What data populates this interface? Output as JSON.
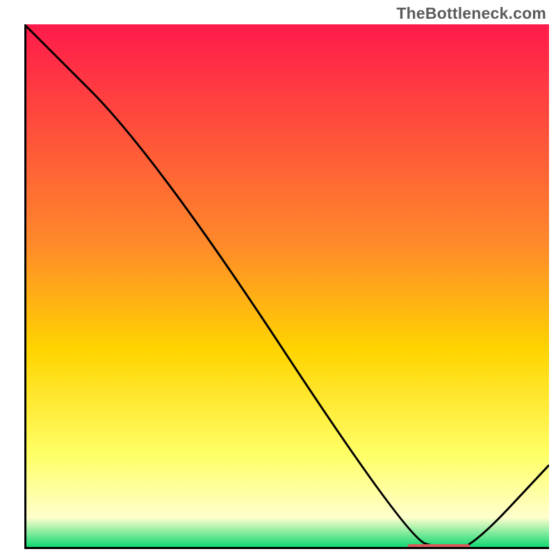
{
  "attribution": "TheBottleneck.com",
  "chart_data": {
    "type": "line",
    "title": "",
    "xlabel": "",
    "ylabel": "",
    "xlim": [
      0,
      100
    ],
    "ylim": [
      0,
      100
    ],
    "x": [
      0,
      25,
      73,
      80,
      85,
      100
    ],
    "values": [
      100,
      75,
      2,
      0,
      0,
      16
    ],
    "colors": {
      "gradient_top": "#ff1a4b",
      "gradient_mid_upper": "#ff8a2a",
      "gradient_mid": "#ffd400",
      "gradient_lower": "#ffff66",
      "gradient_pale": "#ffffcc",
      "gradient_bottom": "#00d66b",
      "axis": "#000000",
      "curve": "#000000",
      "marker": "#d85a5a"
    },
    "marker": {
      "x_start": 73,
      "x_end": 85,
      "y": 0.4
    }
  }
}
